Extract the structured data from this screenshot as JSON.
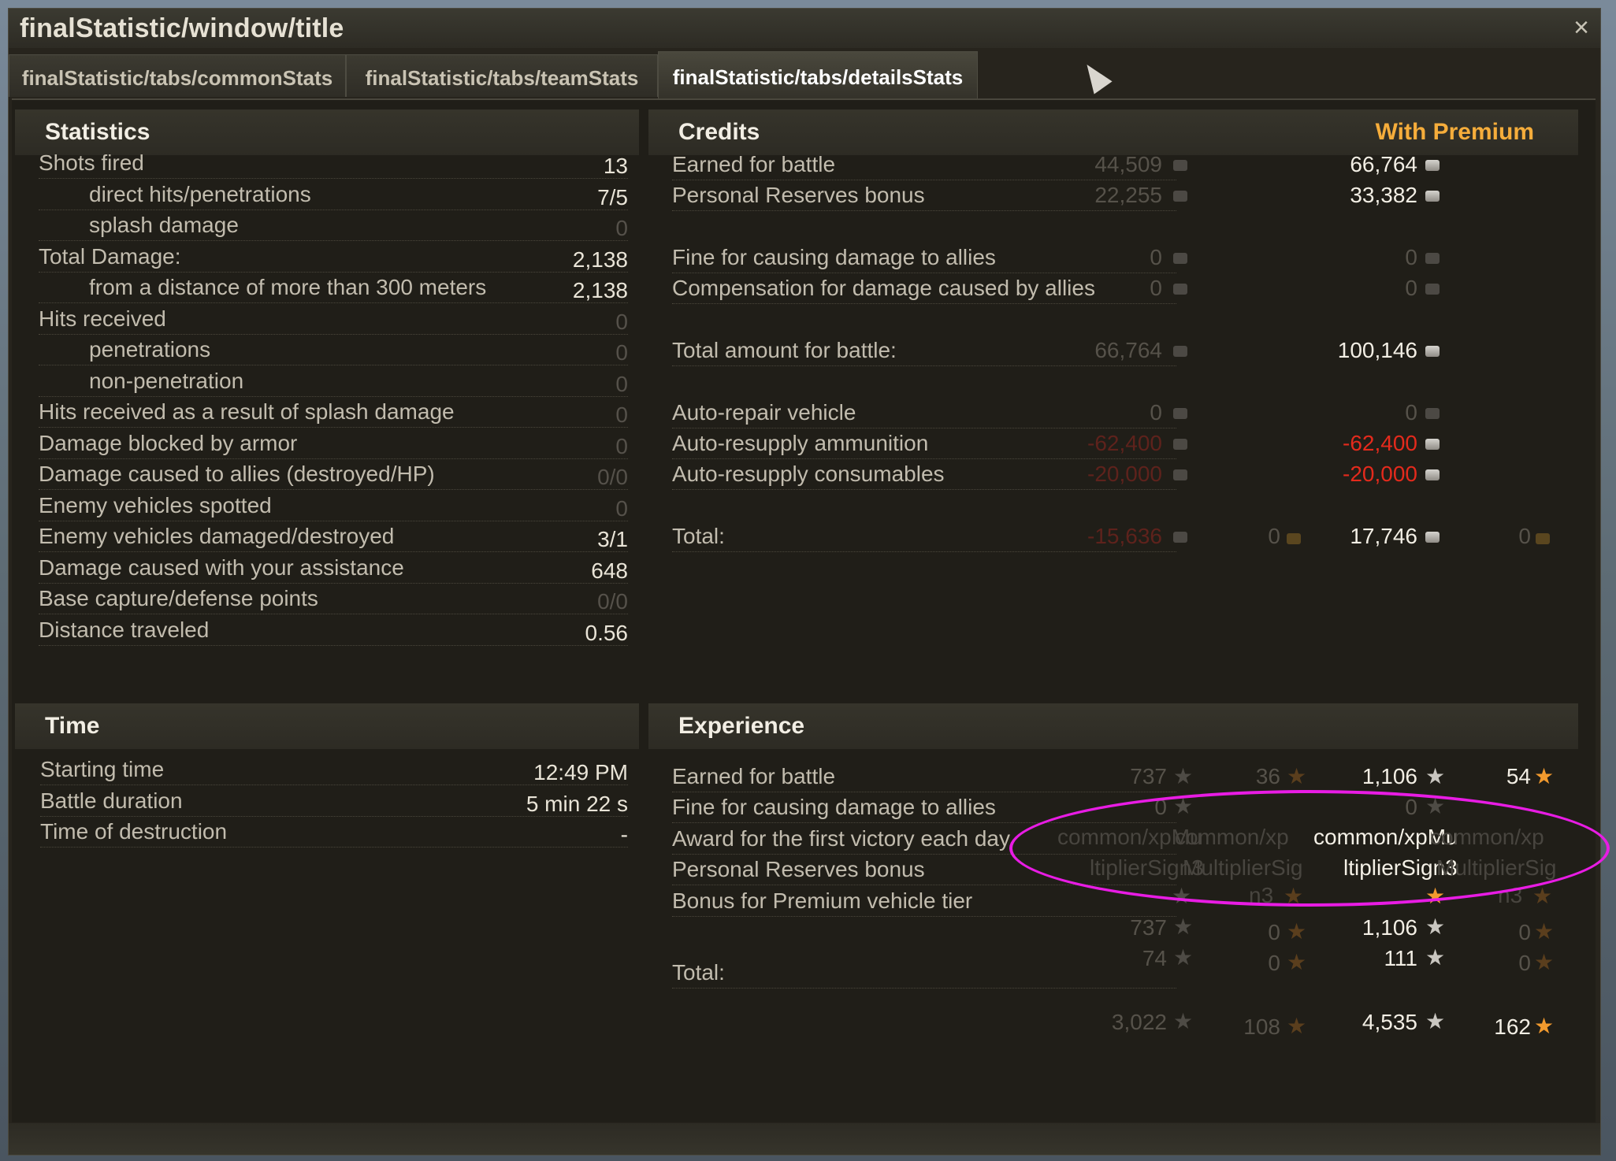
{
  "window": {
    "title": "finalStatistic/window/title",
    "close_icon": "×"
  },
  "tabs": [
    {
      "label": "finalStatistic/tabs/commonStats",
      "active": false
    },
    {
      "label": "finalStatistic/tabs/teamStats",
      "active": false
    },
    {
      "label": "finalStatistic/tabs/detailsStats",
      "active": true
    }
  ],
  "statistics": {
    "title": "Statistics",
    "rows": [
      {
        "label": "Shots fired",
        "value": "13"
      },
      {
        "label": "direct hits/penetrations",
        "value": "7/5"
      },
      {
        "label": "splash damage",
        "value": "0"
      },
      {
        "label": "Total Damage:",
        "value": "2,138"
      },
      {
        "label": "from a distance of more than 300 meters",
        "value": "2,138"
      },
      {
        "label": "Hits received",
        "value": "0"
      },
      {
        "label": "penetrations",
        "value": "0"
      },
      {
        "label": "non-penetration",
        "value": "0"
      },
      {
        "label": "Hits received as a result of splash damage",
        "value": "0"
      },
      {
        "label": "Damage blocked by armor",
        "value": "0"
      },
      {
        "label": "Damage caused to allies (destroyed/HP)",
        "value": "0/0"
      },
      {
        "label": "Enemy vehicles spotted",
        "value": "0"
      },
      {
        "label": "Enemy vehicles damaged/destroyed",
        "value": "3/1"
      },
      {
        "label": "Damage caused with your assistance",
        "value": "648"
      },
      {
        "label": "Base capture/defense points",
        "value": "0/0"
      },
      {
        "label": "Distance traveled",
        "value": "0.56"
      }
    ]
  },
  "time": {
    "title": "Time",
    "rows": [
      {
        "label": "Starting time",
        "value": "12:49 PM"
      },
      {
        "label": "Battle duration",
        "value": "5 min 22 s"
      },
      {
        "label": "Time of destruction",
        "value": "-"
      }
    ]
  },
  "credits": {
    "title": "Credits",
    "premium_label": "With Premium",
    "rows": [
      {
        "label": "Earned for battle",
        "base": "44,509",
        "premium": "66,764"
      },
      {
        "label": "Personal Reserves bonus",
        "base": "22,255",
        "premium": "33,382"
      },
      {
        "label": "Fine for causing damage to allies",
        "base": "0",
        "premium": "0"
      },
      {
        "label": "Compensation for damage caused by allies",
        "base": "0",
        "premium": "0"
      },
      {
        "label": "Total amount for battle:",
        "base": "66,764",
        "premium": "100,146"
      },
      {
        "label": "Auto-repair vehicle",
        "base": "0",
        "premium": "0"
      },
      {
        "label": "Auto-resupply ammunition",
        "base": "-62,400",
        "premium": "-62,400"
      },
      {
        "label": "Auto-resupply consumables",
        "base": "-20,000",
        "premium": "-20,000"
      },
      {
        "label": "Total:",
        "base": "-15,636",
        "base_gold": "0",
        "premium": "17,746",
        "premium_gold": "0"
      }
    ]
  },
  "experience": {
    "title": "Experience",
    "rows": [
      {
        "label": "Earned for battle"
      },
      {
        "label": "Fine for causing damage to allies"
      },
      {
        "label": "Award for the first victory each day"
      },
      {
        "label": "Personal Reserves bonus"
      },
      {
        "label": "Bonus for Premium vehicle tier"
      },
      {
        "label": "Total:"
      }
    ],
    "values": {
      "earned_base_xp": "737",
      "earned_base_free": "36",
      "earned_prem_xp": "1,106",
      "earned_prem_free": "54",
      "fine_base": "0",
      "fine_prem": "0",
      "placeholder_a": "common/xpMu",
      "placeholder_b": "common/xp",
      "placeholder_c": "ltiplierSign3",
      "placeholder_d": "MultiplierSig",
      "placeholder_e": "n3",
      "reserves_base_xp": "737",
      "reserves_base_free": "0",
      "reserves_prem_xp": "1,106",
      "reserves_prem_free": "0",
      "tier_base_xp": "74",
      "tier_base_free": "0",
      "tier_prem_xp": "111",
      "tier_prem_free": "0",
      "total_base_xp": "3,022",
      "total_base_free": "108",
      "total_prem_xp": "4,535",
      "total_prem_free": "162"
    }
  },
  "icons": {
    "silver": "credits-icon",
    "gold": "gold-icon",
    "xp": "star-icon",
    "free_xp": "free-xp-star-icon"
  },
  "colors": {
    "premium_orange": "#f6ad3b",
    "negative_red": "#e42a1c",
    "highlight_magenta": "#e81ce4"
  }
}
